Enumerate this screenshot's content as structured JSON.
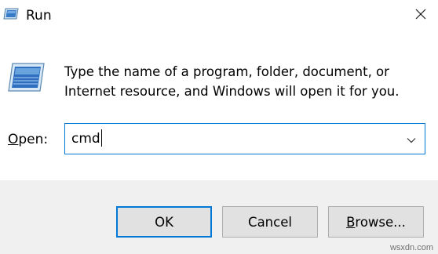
{
  "window": {
    "title": "Run",
    "close_icon": "close-icon",
    "app_icon": "run-icon"
  },
  "content": {
    "icon": "run-icon",
    "description": "Type the name of a program, folder, document, or Internet resource, and Windows will open it for you.",
    "open_label_accel": "O",
    "open_label_rest": "pen:",
    "open_value": "cmd",
    "dropdown_icon": "chevron-down-icon"
  },
  "buttons": {
    "ok": "OK",
    "cancel": "Cancel",
    "browse_accel": "B",
    "browse_rest": "rowse..."
  },
  "watermark": "wsxdn.com",
  "colors": {
    "accent": "#0078d7",
    "footer_bg": "#f0f0f0",
    "button_bg": "#e1e1e1",
    "button_border": "#adadad"
  }
}
